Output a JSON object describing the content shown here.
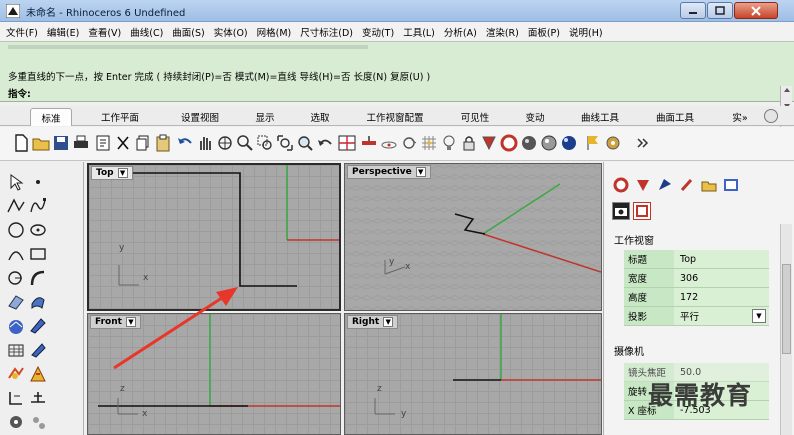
{
  "window": {
    "title": "未命名 - Rhinoceros 6 Undefined"
  },
  "menu": [
    "文件(F)",
    "编辑(E)",
    "查看(V)",
    "曲线(C)",
    "曲面(S)",
    "实体(O)",
    "网格(M)",
    "尺寸标注(D)",
    "变动(T)",
    "工具(L)",
    "分析(A)",
    "渲染(R)",
    "面板(P)",
    "说明(H)"
  ],
  "command": {
    "line2": "多重直线的下一点，按 Enter 完成 ( 持续封闭(P)=否  模式(M)=直线  导线(H)=否  长度(N)  复原(U) )",
    "prompt_label": "指令:",
    "input_value": ""
  },
  "tabs": [
    {
      "label": "标准",
      "active": true
    },
    {
      "label": "工作平面"
    },
    {
      "label": "设置视图"
    },
    {
      "label": "显示"
    },
    {
      "label": "选取"
    },
    {
      "label": "工作视窗配置"
    },
    {
      "label": "可见性"
    },
    {
      "label": "变动"
    },
    {
      "label": "曲线工具"
    },
    {
      "label": "曲面工具"
    },
    {
      "label": "实»"
    }
  ],
  "viewports": {
    "top": {
      "label": "Top"
    },
    "perspective": {
      "label": "Perspective"
    },
    "front": {
      "label": "Front"
    },
    "right": {
      "label": "Right"
    },
    "axis_x": "x",
    "axis_y": "y",
    "axis_z": "z"
  },
  "panel": {
    "section_viewport": "工作视窗",
    "properties": [
      {
        "key": "标题",
        "value": "Top"
      },
      {
        "key": "宽度",
        "value": "306"
      },
      {
        "key": "高度",
        "value": "172"
      },
      {
        "key": "投影",
        "value": "平行"
      }
    ],
    "section_camera": "摄像机",
    "camera_rows": [
      {
        "key": "镜头焦距",
        "value": "50.0"
      },
      {
        "key": "旋转",
        "value": ""
      },
      {
        "key": "X 座标",
        "value": "-7.503"
      }
    ]
  },
  "watermark": "最需教育",
  "colors": {
    "command_bg": "#d7ecd2",
    "viewport_grid": "#a8a8a8",
    "axis_red": "#c0342b",
    "axis_green": "#39a845",
    "annotation_arrow": "#e8372a"
  }
}
